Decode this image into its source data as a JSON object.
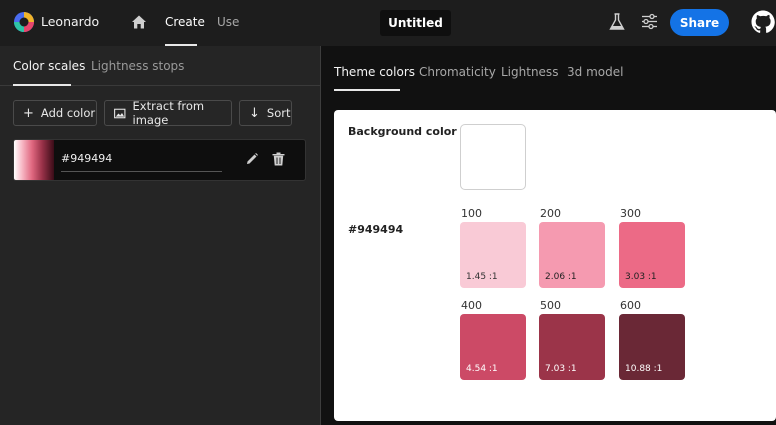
{
  "app": {
    "name": "Leonardo"
  },
  "nav": {
    "create": "Create",
    "use": "Use"
  },
  "document": {
    "title": "Untitled"
  },
  "header": {
    "share_label": "Share"
  },
  "left_tabs": {
    "color_scales": "Color scales",
    "lightness_stops": "Lightness stops"
  },
  "actions": {
    "add_color": "Add color",
    "extract": "Extract from image",
    "sort": "Sort"
  },
  "color_list": [
    {
      "name": "#949494"
    }
  ],
  "right_tabs": {
    "theme": "Theme colors",
    "chroma": "Chromaticity",
    "lightness": "Lightness",
    "model3d": "3d model"
  },
  "theme": {
    "background_label": "Background color",
    "background_color": "#ffffff",
    "key_color_label": "#949494",
    "swatches": [
      {
        "step": "100",
        "ratio": "1.45 :1",
        "color": "#f9cad6",
        "text_color": "#333333"
      },
      {
        "step": "200",
        "ratio": "2.06 :1",
        "color": "#f59ab0",
        "text_color": "#222222"
      },
      {
        "step": "300",
        "ratio": "3.03 :1",
        "color": "#ec6a86",
        "text_color": "#222222"
      },
      {
        "step": "400",
        "ratio": "4.54 :1",
        "color": "#cc4a66",
        "text_color": "#ffffff"
      },
      {
        "step": "500",
        "ratio": "7.03 :1",
        "color": "#9b3449",
        "text_color": "#ffffff"
      },
      {
        "step": "600",
        "ratio": "10.88 :1",
        "color": "#6a2836",
        "text_color": "#ffffff"
      }
    ]
  },
  "colors": {
    "accent": "#1473e6"
  }
}
